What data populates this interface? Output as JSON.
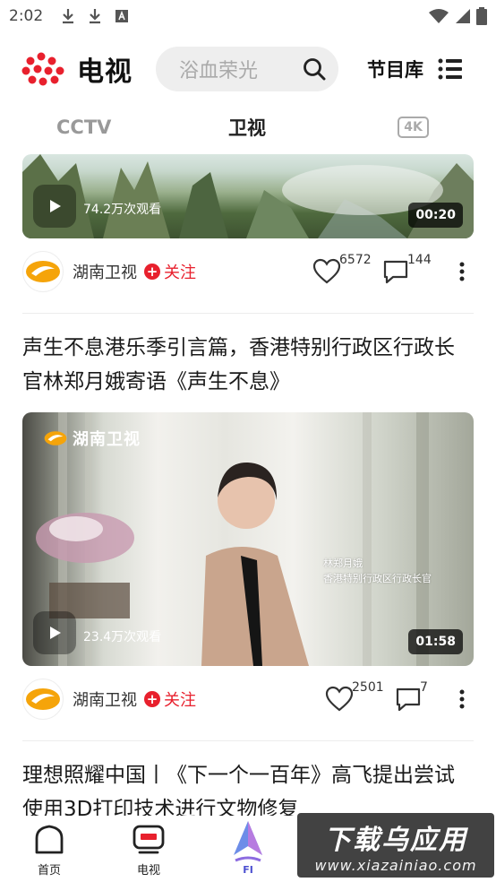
{
  "status_bar": {
    "time": "2:02"
  },
  "header": {
    "app_title": "电视",
    "search_placeholder": "浴血荣光",
    "library_label": "节目库"
  },
  "tabs": [
    {
      "label": "CCTV",
      "active": false
    },
    {
      "label": "卫视",
      "active": true
    },
    {
      "label": "4K",
      "active": false
    }
  ],
  "feed": [
    {
      "views": "74.2万次观看",
      "duration": "00:20",
      "channel": "湖南卫视",
      "follow_label": "关注",
      "likes": "6572",
      "comments": "144"
    },
    {
      "title": "声生不息港乐季引言篇，香港特别行政区行政长官林郑月娥寄语《声生不息》",
      "brand_overlay": "湖南卫视",
      "caption_line1": "林郑月娥",
      "caption_line2": "香港特别行政区行政长官",
      "views": "23.4万次观看",
      "duration": "01:58",
      "channel": "湖南卫视",
      "follow_label": "关注",
      "likes": "2501",
      "comments": "7"
    },
    {
      "title": "理想照耀中国丨《下一个一百年》高飞提出尝试使用3D打印技术进行文物修复"
    }
  ],
  "bottom_nav": [
    {
      "label": "首页",
      "icon": "home-icon"
    },
    {
      "label": "电视",
      "icon": "tv-icon"
    },
    {
      "label": "",
      "icon": "ceremony-logo"
    },
    {
      "label": "",
      "icon": "nav-item-4"
    },
    {
      "label": "",
      "icon": "nav-item-5"
    }
  ],
  "watermark": {
    "main": "下载乌应用",
    "sub": "www.xiazainiao.com"
  },
  "colors": {
    "accent_red": "#e8202d",
    "text_dark": "#1a1a1a",
    "muted": "#999999"
  }
}
